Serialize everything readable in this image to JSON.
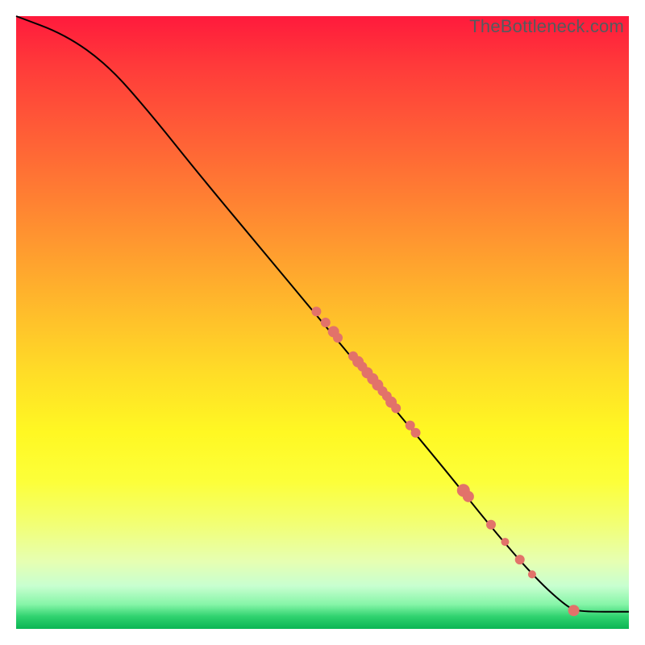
{
  "watermark": "TheBottleneck.com",
  "chart_data": {
    "type": "line",
    "title": "",
    "xlabel": "",
    "ylabel": "",
    "xlim": [
      0,
      100
    ],
    "ylim": [
      0,
      100
    ],
    "grid": false,
    "legend": false,
    "background_gradient": {
      "top_color": "#ff1a3c",
      "middle_color": "#fff823",
      "bottom_color": "#0bb554"
    },
    "series": [
      {
        "name": "curve",
        "kind": "line",
        "points": [
          {
            "x": 0,
            "y": 100
          },
          {
            "x": 8,
            "y": 97
          },
          {
            "x": 15,
            "y": 92
          },
          {
            "x": 22,
            "y": 84
          },
          {
            "x": 30,
            "y": 74
          },
          {
            "x": 40,
            "y": 62
          },
          {
            "x": 50,
            "y": 50
          },
          {
            "x": 60,
            "y": 38
          },
          {
            "x": 70,
            "y": 26
          },
          {
            "x": 78,
            "y": 16
          },
          {
            "x": 85,
            "y": 8
          },
          {
            "x": 90,
            "y": 3.5
          },
          {
            "x": 92,
            "y": 2.8
          },
          {
            "x": 100,
            "y": 2.8
          }
        ]
      },
      {
        "name": "markers",
        "kind": "scatter",
        "points": [
          {
            "x": 49.0,
            "y": 51.8,
            "size": 6
          },
          {
            "x": 50.5,
            "y": 50.0,
            "size": 6
          },
          {
            "x": 51.8,
            "y": 48.5,
            "size": 7
          },
          {
            "x": 52.5,
            "y": 47.5,
            "size": 6
          },
          {
            "x": 55.0,
            "y": 44.5,
            "size": 6
          },
          {
            "x": 55.8,
            "y": 43.6,
            "size": 7
          },
          {
            "x": 56.5,
            "y": 42.8,
            "size": 6
          },
          {
            "x": 57.3,
            "y": 41.8,
            "size": 7
          },
          {
            "x": 58.2,
            "y": 40.8,
            "size": 7
          },
          {
            "x": 59.0,
            "y": 39.8,
            "size": 7
          },
          {
            "x": 59.8,
            "y": 38.8,
            "size": 6
          },
          {
            "x": 60.5,
            "y": 38.0,
            "size": 6
          },
          {
            "x": 61.2,
            "y": 37.0,
            "size": 7
          },
          {
            "x": 62.0,
            "y": 36.0,
            "size": 6
          },
          {
            "x": 64.3,
            "y": 33.2,
            "size": 6
          },
          {
            "x": 65.2,
            "y": 32.0,
            "size": 6
          },
          {
            "x": 73.0,
            "y": 22.6,
            "size": 8
          },
          {
            "x": 73.8,
            "y": 21.6,
            "size": 7
          },
          {
            "x": 77.5,
            "y": 17.0,
            "size": 6
          },
          {
            "x": 79.8,
            "y": 14.2,
            "size": 5
          },
          {
            "x": 82.2,
            "y": 11.3,
            "size": 6
          },
          {
            "x": 84.2,
            "y": 8.9,
            "size": 5
          },
          {
            "x": 91.0,
            "y": 3.0,
            "size": 7
          }
        ]
      }
    ]
  }
}
